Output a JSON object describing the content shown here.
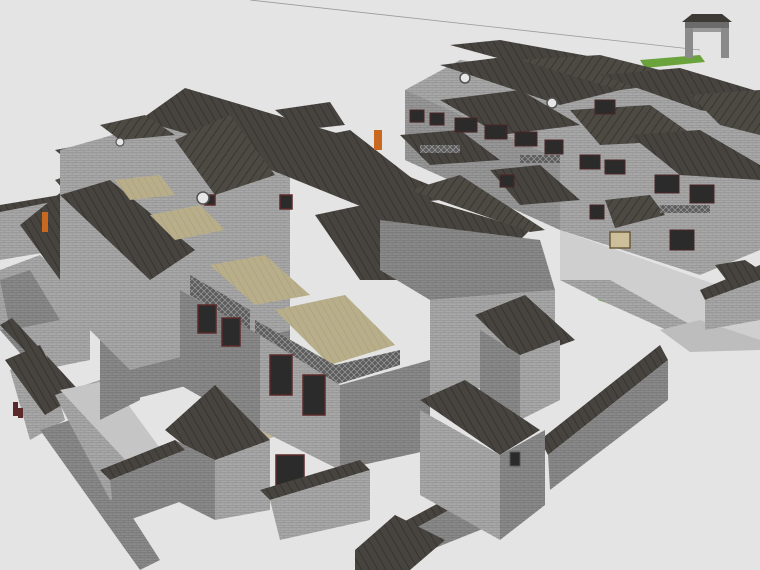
{
  "viewport": {
    "background": "#e4e4e4"
  },
  "colors": {
    "roof": "#4a4640",
    "roof_dark": "#3a3732",
    "roof_ridge": "#2e2c29",
    "wall_light": "#b9b9b9",
    "wall_mid": "#9a9a9a",
    "wall_dark": "#7e7e7e",
    "terrace": "#b7ac88",
    "door": "#c9691f",
    "window_frame": "#5a2a2a",
    "grass": "#6aa23c"
  },
  "model": {
    "objects": [
      {
        "name": "main-house"
      },
      {
        "name": "west-wing"
      },
      {
        "name": "north-complex"
      },
      {
        "name": "north-gate"
      },
      {
        "name": "courtyard-walls"
      },
      {
        "name": "south-gatehouse"
      }
    ]
  }
}
